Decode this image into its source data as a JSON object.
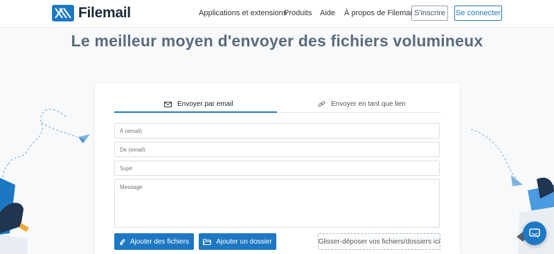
{
  "header": {
    "brand": "Filemail",
    "nav": {
      "apps": "Applications et extensions",
      "products": "Produits",
      "help": "Aide",
      "about": "À propos de Filemail"
    },
    "signup_label": "S'inscrire",
    "login_label": "Se connecter"
  },
  "hero": {
    "title": "Le meilleur moyen d'envoyer des fichiers volumineux"
  },
  "tabs": {
    "email_label": "Envoyer par email",
    "link_label": "Envoyer en tant que lien"
  },
  "form": {
    "to_placeholder": "À (email)",
    "from_placeholder": "De (email)",
    "subject_placeholder": "Sujet",
    "message_placeholder": "Message"
  },
  "actions": {
    "add_files_label": "Ajouter des fichiers",
    "add_folder_label": "Ajouter un dossier",
    "dropzone_label": "Glisser-déposer vos fichiers/dossiers ici"
  },
  "colors": {
    "accent": "#1d78c4",
    "title": "#5a6b7d",
    "illustration_dark": "#1f3550"
  },
  "icons": {
    "email_tab": "envelope-icon",
    "link_tab": "link-icon",
    "files_button": "paperclip-icon",
    "folder_button": "folder-icon",
    "chat": "chat-icon"
  }
}
